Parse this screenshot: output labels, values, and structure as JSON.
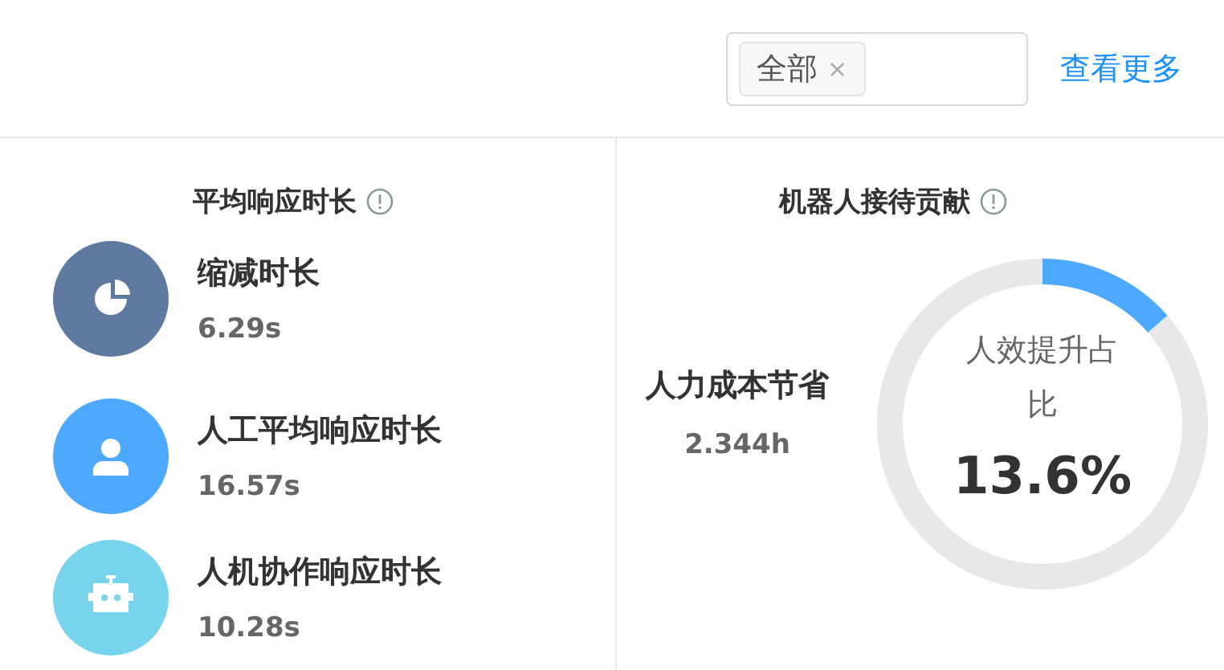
{
  "filter": {
    "tags": [
      {
        "label": "全部",
        "remove": "×"
      }
    ]
  },
  "more_link": "查看更多",
  "response_panel": {
    "title": "平均响应时长",
    "items": [
      {
        "kind": "pie",
        "color": "#5f7aa0",
        "label": "缩减时长",
        "value": "6.29s"
      },
      {
        "kind": "person",
        "color": "#4da9ff",
        "label": "人工平均响应时长",
        "value": "16.57s"
      },
      {
        "kind": "robot",
        "color": "#78d4ec",
        "label": "人机协作响应时长",
        "value": "10.28s"
      }
    ]
  },
  "robot_panel": {
    "title": "机器人接待贡献",
    "saving_label": "人力成本节省",
    "saving_value": "2.344h",
    "gauge": {
      "label": "人效提升占比",
      "value": "13.6%"
    }
  }
}
